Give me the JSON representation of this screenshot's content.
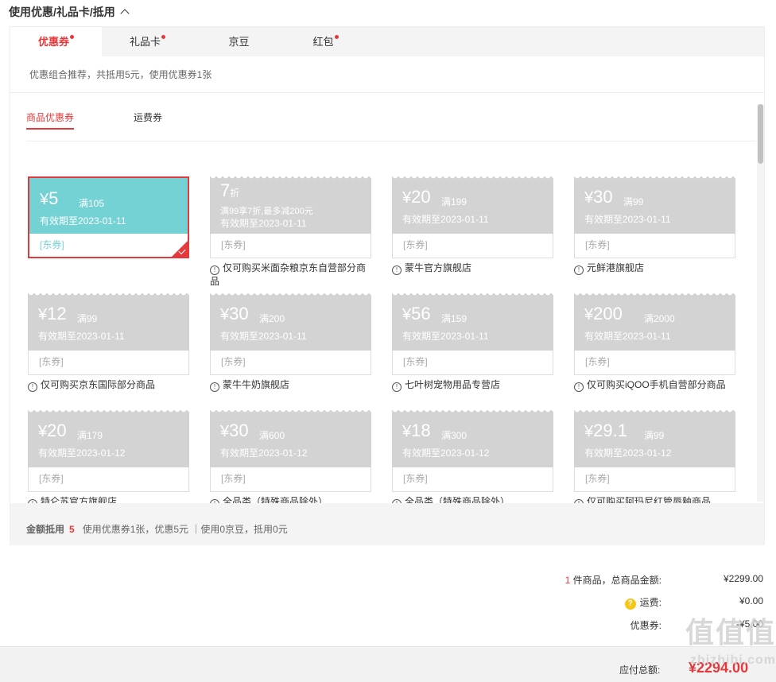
{
  "header": {
    "title": "使用优惠/礼品卡/抵用"
  },
  "tabs": [
    {
      "label": "优惠券",
      "dot": true
    },
    {
      "label": "礼品卡",
      "dot": true
    },
    {
      "label": "京豆",
      "dot": false
    },
    {
      "label": "红包",
      "dot": true
    }
  ],
  "recommend": "优惠组合推荐，共抵用5元，使用优惠券1张",
  "subtabs": [
    "商品优惠券",
    "运费券"
  ],
  "coupons": [
    {
      "currency": "¥",
      "amount": "5",
      "cond": "满105",
      "valid": "有效期至2023-01-11",
      "tag": "[东券]",
      "note": "",
      "selected": true
    },
    {
      "amount": "7",
      "unit": "折",
      "desc": "满99享7折,最多减200元",
      "valid": "有效期至2023-01-11",
      "tag": "[东券]",
      "note": "仅可购买米面杂粮京东自营部分商品"
    },
    {
      "currency": "¥",
      "amount": "20",
      "cond": "满199",
      "valid": "有效期至2023-01-11",
      "tag": "[东券]",
      "note": "蒙牛官方旗舰店"
    },
    {
      "currency": "¥",
      "amount": "30",
      "cond": "满99",
      "valid": "有效期至2023-01-11",
      "tag": "[东券]",
      "note": "元鲜港旗舰店"
    },
    {
      "currency": "¥",
      "amount": "12",
      "cond": "满99",
      "valid": "有效期至2023-01-11",
      "tag": "[东券]",
      "note": "仅可购买京东国际部分商品"
    },
    {
      "currency": "¥",
      "amount": "30",
      "cond": "满200",
      "valid": "有效期至2023-01-11",
      "tag": "[东券]",
      "note": "蒙牛牛奶旗舰店"
    },
    {
      "currency": "¥",
      "amount": "56",
      "cond": "满159",
      "valid": "有效期至2023-01-11",
      "tag": "[东券]",
      "note": "七叶树宠物用品专营店"
    },
    {
      "currency": "¥",
      "amount": "200",
      "cond": "满2000",
      "valid": "有效期至2023-01-11",
      "tag": "[东券]",
      "note": "仅可购买iQOO手机自营部分商品"
    },
    {
      "currency": "¥",
      "amount": "20",
      "cond": "满179",
      "valid": "有效期至2023-01-12",
      "tag": "[东券]",
      "note": "特仑苏官方旗舰店"
    },
    {
      "currency": "¥",
      "amount": "30",
      "cond": "满600",
      "valid": "有效期至2023-01-12",
      "tag": "[东券]",
      "note": "全品类（特殊商品除外）"
    },
    {
      "currency": "¥",
      "amount": "18",
      "cond": "满300",
      "valid": "有效期至2023-01-12",
      "tag": "[东券]",
      "note": "全品类（特殊商品除外）"
    },
    {
      "currency": "¥",
      "amount": "29.1",
      "cond": "满99",
      "valid": "有效期至2023-01-12",
      "tag": "[东券]",
      "note": "仅可购买阿玛尼红管唇釉商品"
    }
  ],
  "note_icon": "!",
  "footer": {
    "label": "金额抵用",
    "amount": "5",
    "detail": "使用优惠券1张，优惠5元 ｜使用0京豆，抵用0元"
  },
  "summary": {
    "count": "1",
    "goods_label": "件商品，总商品金额:",
    "goods_value": "¥2299.00",
    "shipping_label": "运费:",
    "shipping_value": "¥0.00",
    "coupon_label": "优惠券:",
    "coupon_value": "-¥5.00"
  },
  "pay": {
    "label": "应付总额:",
    "value": "¥2294.00"
  },
  "watermark": {
    "line1": "值值值",
    "line2": "zhizhibi.com"
  },
  "colors": {
    "accent": "#e4393c",
    "selected_coupon": "#74d2d4",
    "disabled_coupon": "#d3d3d3"
  }
}
